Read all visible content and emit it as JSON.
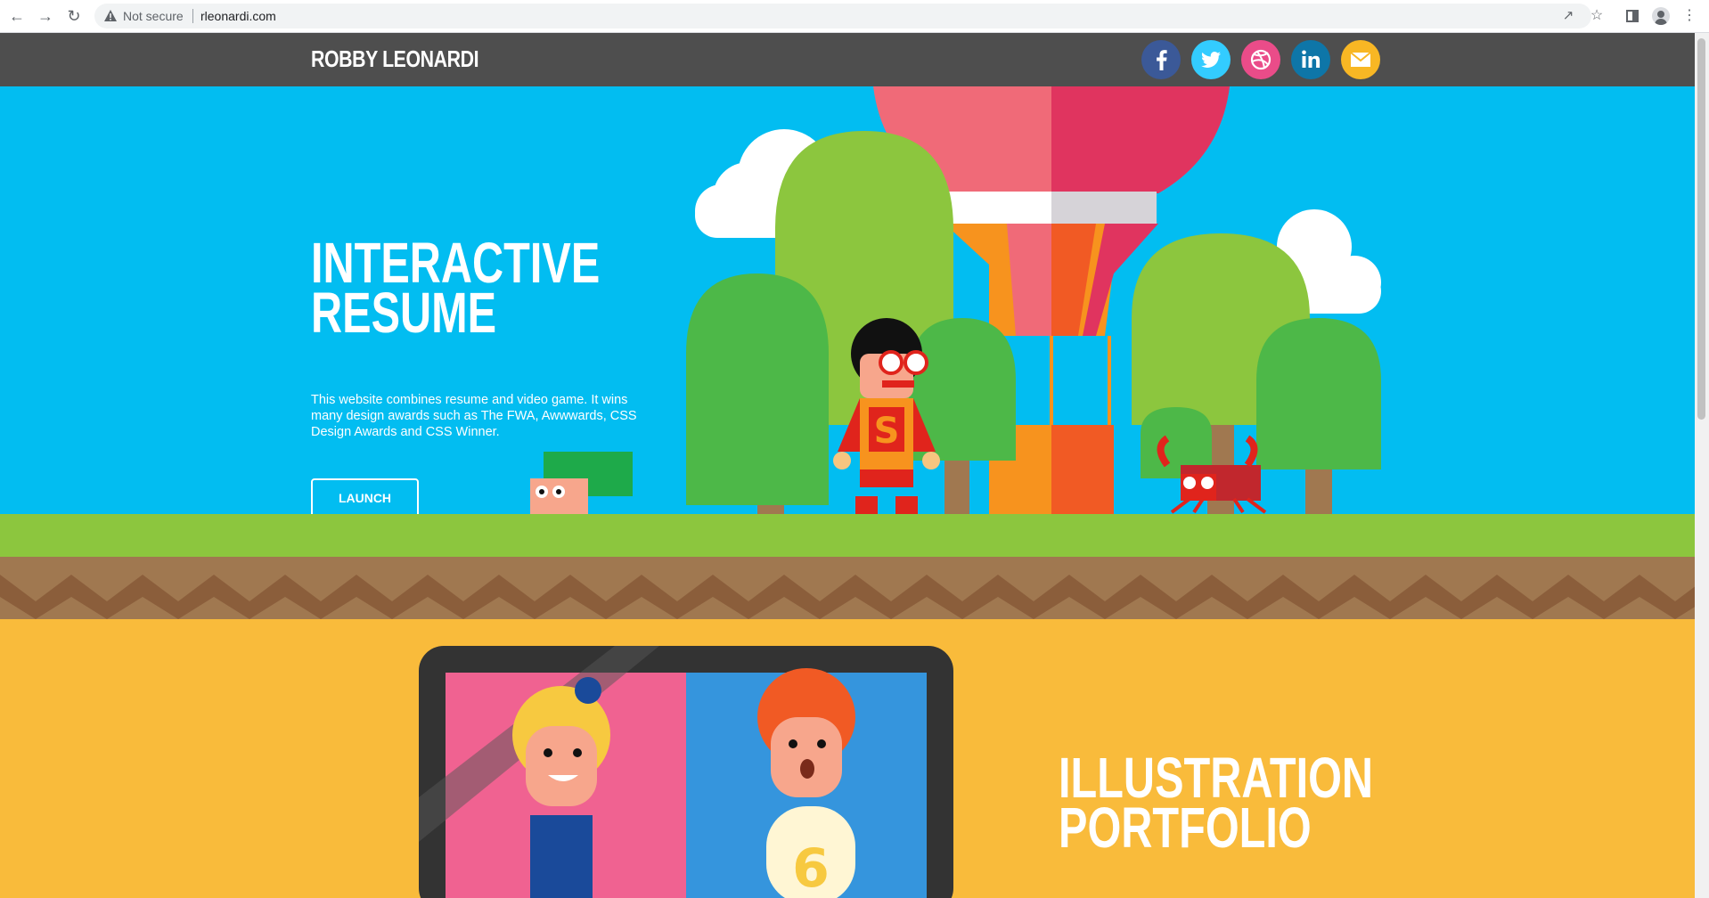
{
  "browser": {
    "security_label": "Not secure",
    "url": "rleonardi.com",
    "icons": [
      "back-icon",
      "forward-icon",
      "reload-icon",
      "warning-icon",
      "share-icon",
      "bookmark-star-icon",
      "side-panel-icon",
      "profile-icon",
      "menu-kebab-icon"
    ]
  },
  "header": {
    "logo": "ROBBY LEONARDI",
    "social": [
      {
        "name": "facebook-icon",
        "color": "#3b5998"
      },
      {
        "name": "twitter-icon",
        "color": "#33ccff"
      },
      {
        "name": "dribbble-icon",
        "color": "#ea4c89"
      },
      {
        "name": "linkedin-icon",
        "color": "#0e76a8"
      },
      {
        "name": "mail-icon",
        "color": "#f8b724"
      }
    ]
  },
  "hero": {
    "title_line1": "INTERACTIVE",
    "title_line2": "RESUME",
    "description": "This website combines resume and video game. It wins many design awards such as The FWA, Awwwards, CSS Design Awards and CSS Winner.",
    "button_label": "LAUNCH WEBSITE",
    "background_color": "#02bdf1"
  },
  "portfolio": {
    "title_line1": "ILLUSTRATION",
    "title_line2": "PORTFOLIO",
    "background_color": "#f9bb3b"
  }
}
